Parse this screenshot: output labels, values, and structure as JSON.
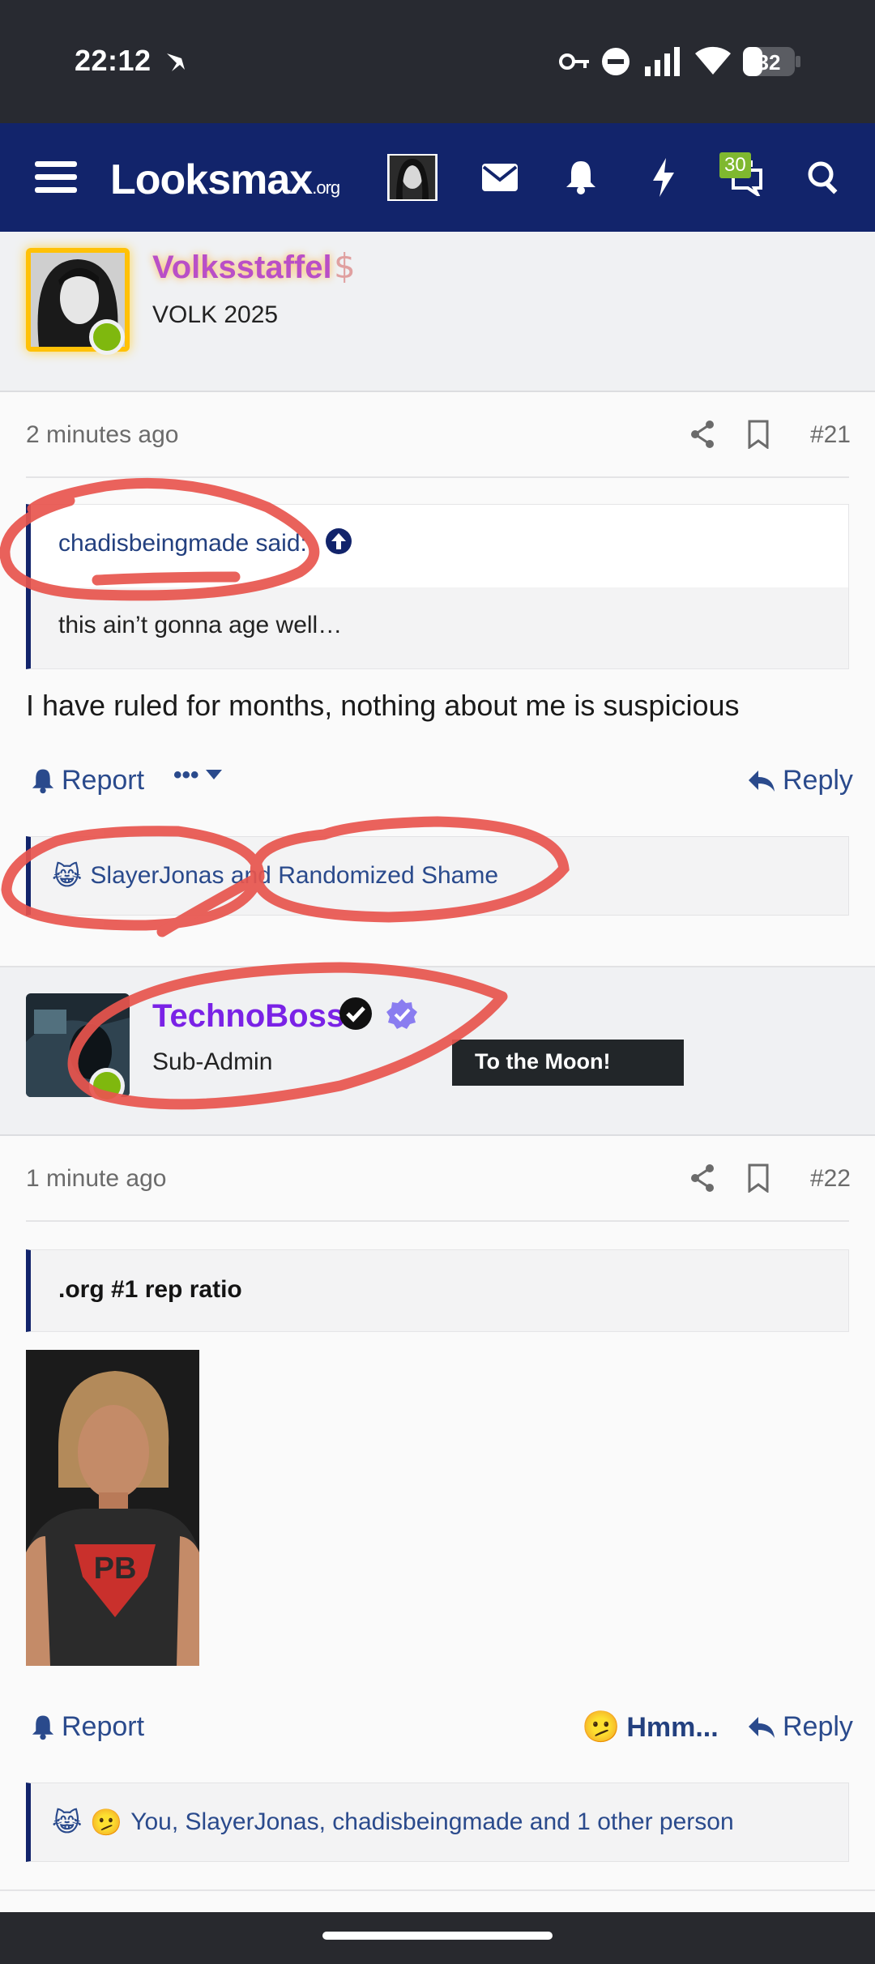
{
  "status_bar": {
    "time": "22:12",
    "battery": "32"
  },
  "navbar": {
    "logo_main": "Looksmax",
    "logo_suffix": ".org",
    "conversations_badge": "30"
  },
  "post21": {
    "user": {
      "name": "Volksstaffel",
      "title": "VOLK 2025"
    },
    "time": "2 minutes ago",
    "number": "#21",
    "quote_author": "chadisbeingmade said:",
    "quote_text": "this ain’t gonna age well…",
    "message": "I have ruled for months, nothing about me is suspicious",
    "report_label": "Report",
    "more_label": "•••",
    "reply_label": "Reply",
    "reactions_text": "SlayerJonas and Randomized Shame"
  },
  "post22": {
    "user": {
      "name": "TechnoBoss",
      "title": "Sub-Admin"
    },
    "tooltip": "To the Moon!",
    "time": "1 minute ago",
    "number": "#22",
    "quote_text": ".org #1 rep ratio",
    "report_label": "Report",
    "reaction_label": "Hmm...",
    "reply_label": "Reply",
    "reactions_text": "You, SlayerJonas, chadisbeingmade and 1 other person"
  },
  "colors": {
    "nav_bg": "#12246b",
    "link": "#2a4a8c",
    "online": "#7fb80e",
    "volks_name": "#b94fc7",
    "techno_name": "#7a22e6"
  }
}
